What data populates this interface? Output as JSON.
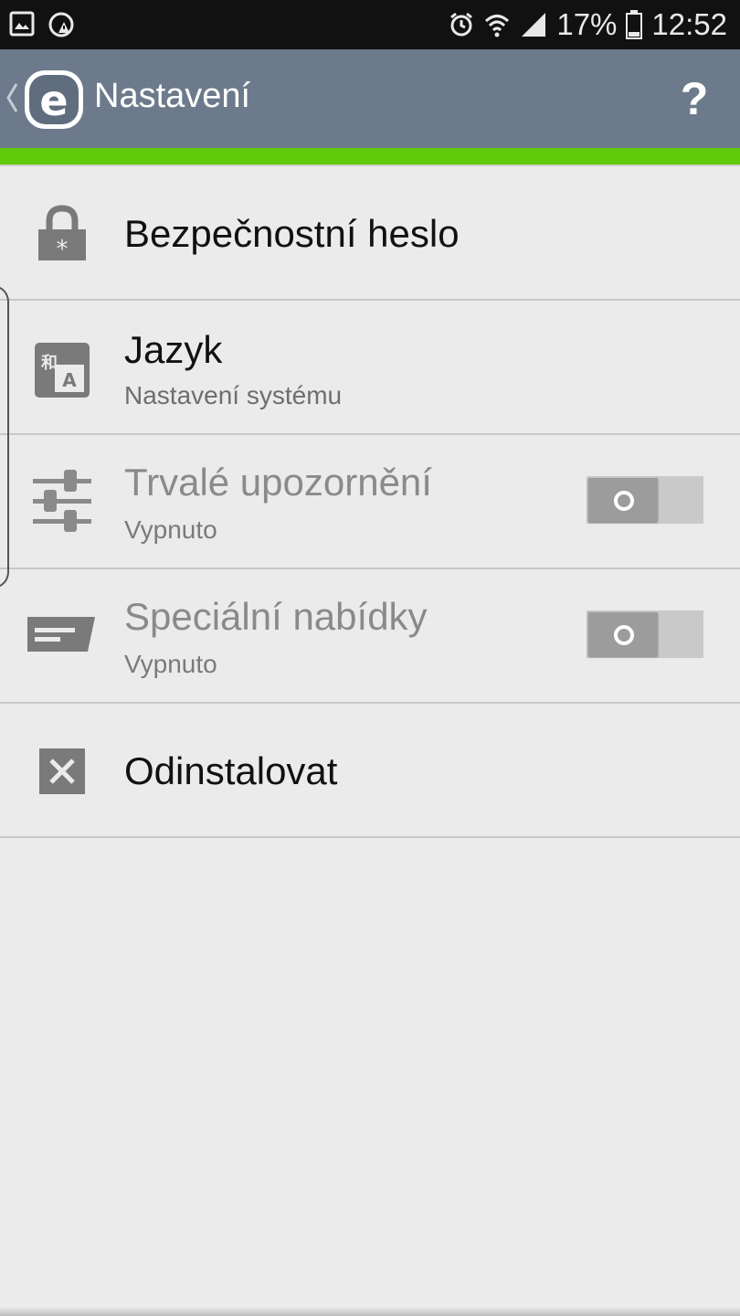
{
  "status_bar": {
    "battery": "17%",
    "time": "12:52",
    "icons": [
      "gallery-icon",
      "screenshot-icon",
      "alarm-icon",
      "wifi-icon",
      "signal-icon",
      "battery-icon"
    ]
  },
  "app_bar": {
    "title": "Nastavení",
    "help_label": "?",
    "logo_letter": "e"
  },
  "settings": [
    {
      "label": "Bezpečnostní heslo",
      "icon": "lock-icon",
      "enabled": true
    },
    {
      "label": "Jazyk",
      "sub": "Nastavení systému",
      "icon": "language-icon",
      "enabled": true
    },
    {
      "label": "Trvalé upozornění",
      "sub": "Vypnuto",
      "icon": "sliders-icon",
      "enabled": false,
      "toggle_on": false
    },
    {
      "label": "Speciální nabídky",
      "sub": "Vypnuto",
      "icon": "offer-tag-icon",
      "enabled": false,
      "toggle_on": false
    },
    {
      "label": "Odinstalovat",
      "icon": "uninstall-icon",
      "enabled": true
    }
  ],
  "colors": {
    "app_bar": "#6c7a8b",
    "accent_line": "#5fcb0b",
    "background": "#ebebeb"
  }
}
